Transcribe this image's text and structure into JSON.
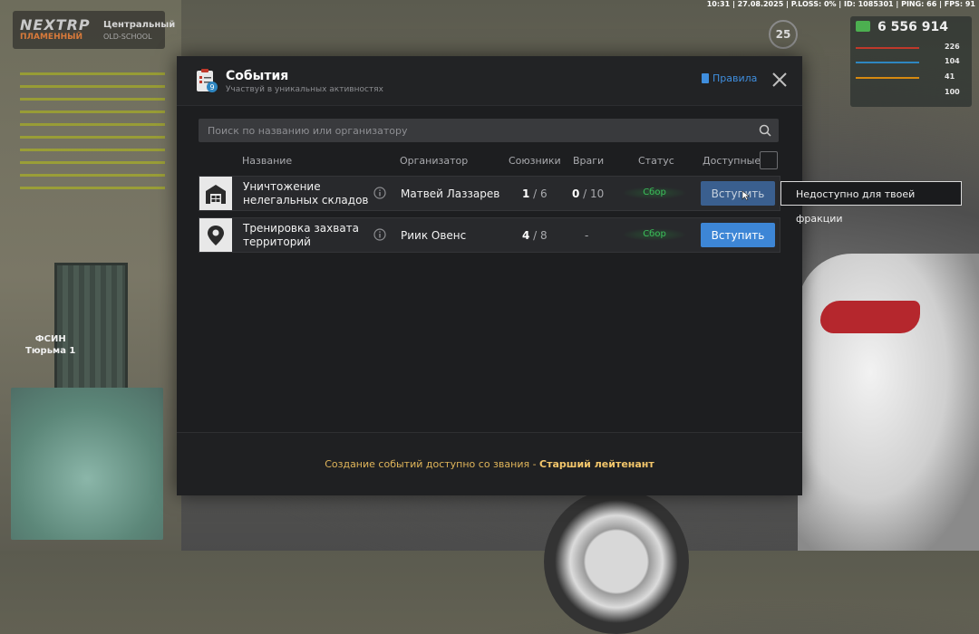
{
  "hud": {
    "topbar": "10:31 | 27.08.2025 | P.LOSS: 0% | ID: 1085301 | PING: 66 | FPS: 91",
    "logo": "NEXTRP",
    "logo_sub": "ПЛАМЕННЫЙ",
    "server_name": "Центральный",
    "server_sub": "OLD-SCHOOL",
    "level": "25",
    "money": "6 556 914",
    "stats": [
      "226",
      "104",
      "41",
      "100"
    ],
    "stat_extra": "100",
    "map_label_1": "ФСИН",
    "map_label_2": "Тюрьма 1"
  },
  "modal": {
    "title": "События",
    "subtitle": "Участвуй в уникальных активностях",
    "rules_label": "Правила",
    "search_placeholder": "Поиск по названию или организатору",
    "columns": {
      "name": "Название",
      "organizer": "Организатор",
      "allies": "Союзники",
      "enemies": "Враги",
      "status": "Статус",
      "available": "Доступные"
    },
    "events": [
      {
        "name": "Уничтожение нелегальных складов",
        "organizer": "Матвей Лаззарев",
        "allies_current": "1",
        "allies_max": "6",
        "enemies_current": "0",
        "enemies_max": "10",
        "status": "Сбор",
        "join_label": "Вступить",
        "icon": "warehouse-icon"
      },
      {
        "name": "Тренировка захвата территорий",
        "organizer": "Риик Овенс",
        "allies_current": "4",
        "allies_max": "8",
        "enemies": "-",
        "status": "Сбор",
        "join_label": "Вступить",
        "icon": "location-pin-icon"
      }
    ],
    "tooltip": "Недоступно для твоей фракции",
    "footer_prefix": "Создание событий доступно со звания - ",
    "footer_rank": "Старший лейтенант"
  },
  "colors": {
    "accent": "#3d86d6",
    "status_green": "#3bbf5a",
    "footer_gold": "#e0b55a"
  }
}
